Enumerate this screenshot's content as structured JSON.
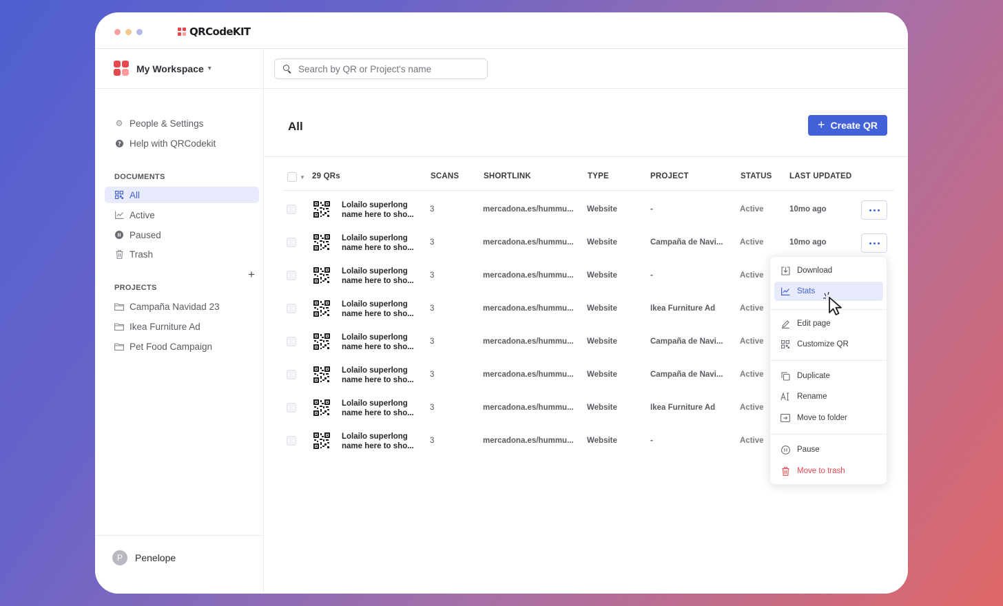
{
  "app": {
    "brand": "QRCodeKIT"
  },
  "workspace": {
    "name": "My Workspace"
  },
  "sidebar": {
    "links": [
      {
        "label": "People & Settings",
        "icon": "gear-icon"
      },
      {
        "label": "Help with QRCodekit",
        "icon": "help-icon"
      }
    ],
    "documents_label": "DOCUMENTS",
    "documents": [
      {
        "label": "All",
        "icon": "qr-grid-icon",
        "active": true
      },
      {
        "label": "Active",
        "icon": "chart-line-icon"
      },
      {
        "label": "Paused",
        "icon": "pause-circle-icon"
      },
      {
        "label": "Trash",
        "icon": "trash-icon"
      }
    ],
    "projects_label": "PROJECTS",
    "projects": [
      {
        "label": "Campaña Navidad 23",
        "icon": "folder-icon"
      },
      {
        "label": "Ikea Furniture Ad",
        "icon": "folder-icon"
      },
      {
        "label": "Pet Food Campaign",
        "icon": "folder-icon"
      }
    ],
    "user": {
      "initial": "P",
      "name": "Penelope"
    }
  },
  "search": {
    "placeholder": "Search by QR or Project's name",
    "value": ""
  },
  "main": {
    "title": "All",
    "create_label": "Create QR"
  },
  "table": {
    "count_label": "29 QRs",
    "columns": {
      "scans": "SCANS",
      "shortlink": "SHORTLINK",
      "type": "TYPE",
      "project": "PROJECT",
      "status": "STATUS",
      "updated": "LAST UPDATED"
    },
    "rows": [
      {
        "name1": "Lolailo superlong",
        "name2": "name here to sho...",
        "scans": "3",
        "shortlink": "mercadona.es/hummu...",
        "type": "Website",
        "project": "-",
        "status": "Active",
        "updated": "10mo ago"
      },
      {
        "name1": "Lolailo superlong",
        "name2": "name here to sho...",
        "scans": "3",
        "shortlink": "mercadona.es/hummu...",
        "type": "Website",
        "project": "Campaña de Navi...",
        "status": "Active",
        "updated": "10mo ago"
      },
      {
        "name1": "Lolailo superlong",
        "name2": "name here to sho...",
        "scans": "3",
        "shortlink": "mercadona.es/hummu...",
        "type": "Website",
        "project": "-",
        "status": "Active",
        "updated": ""
      },
      {
        "name1": "Lolailo superlong",
        "name2": "name here to sho...",
        "scans": "3",
        "shortlink": "mercadona.es/hummu...",
        "type": "Website",
        "project": "Ikea Furniture Ad",
        "status": "Active",
        "updated": ""
      },
      {
        "name1": "Lolailo superlong",
        "name2": "name here to sho...",
        "scans": "3",
        "shortlink": "mercadona.es/hummu...",
        "type": "Website",
        "project": "Campaña de Navi...",
        "status": "Active",
        "updated": ""
      },
      {
        "name1": "Lolailo superlong",
        "name2": "name here to sho...",
        "scans": "3",
        "shortlink": "mercadona.es/hummu...",
        "type": "Website",
        "project": "Campaña de Navi...",
        "status": "Active",
        "updated": ""
      },
      {
        "name1": "Lolailo superlong",
        "name2": "name here to sho...",
        "scans": "3",
        "shortlink": "mercadona.es/hummu...",
        "type": "Website",
        "project": "Ikea Furniture Ad",
        "status": "Active",
        "updated": ""
      },
      {
        "name1": "Lolailo superlong",
        "name2": "name here to sho...",
        "scans": "3",
        "shortlink": "mercadona.es/hummu...",
        "type": "Website",
        "project": "-",
        "status": "Active",
        "updated": ""
      }
    ]
  },
  "context_menu": {
    "items": [
      {
        "label": "Download",
        "icon": "download-icon"
      },
      {
        "label": "Stats",
        "icon": "chart-line-icon",
        "highlighted": true
      },
      {
        "label": "Edit page",
        "icon": "pencil-icon"
      },
      {
        "label": "Customize QR",
        "icon": "qr-grid-icon"
      },
      {
        "label": "Duplicate",
        "icon": "duplicate-icon"
      },
      {
        "label": "Rename",
        "icon": "rename-icon"
      },
      {
        "label": "Move to folder",
        "icon": "move-folder-icon"
      },
      {
        "label": "Pause",
        "icon": "pause-circle-icon"
      },
      {
        "label": "Move to trash",
        "icon": "trash-icon",
        "danger": true
      }
    ]
  },
  "colors": {
    "accent": "#4361d8",
    "brand_red": "#e5484d",
    "highlight_bg": "#e8ebfb"
  }
}
